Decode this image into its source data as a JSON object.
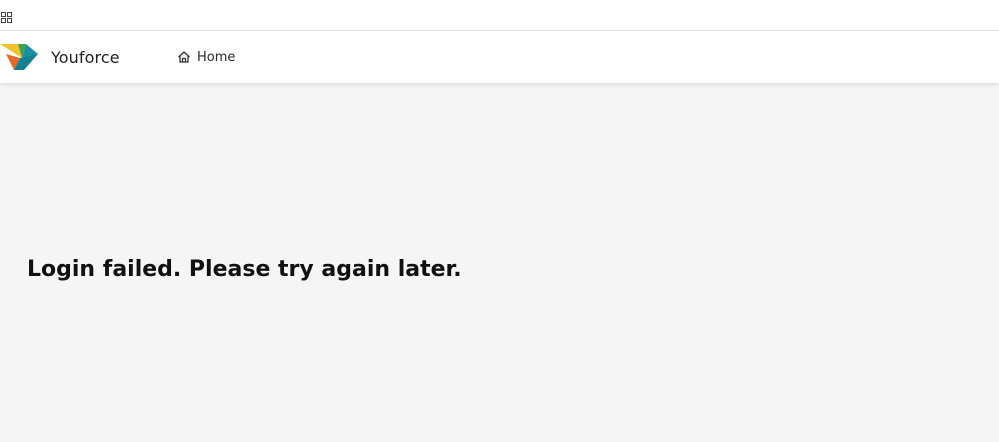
{
  "header": {
    "brand_name": "Youforce",
    "brand_colors": [
      "#f2c12e",
      "#3fa34d",
      "#e8682a",
      "#1b8ea5"
    ],
    "nav": {
      "home_label": "Home",
      "home_icon": "home-icon"
    },
    "apps_icon": "grid-icon"
  },
  "main": {
    "message": "Login failed. Please try again later."
  }
}
